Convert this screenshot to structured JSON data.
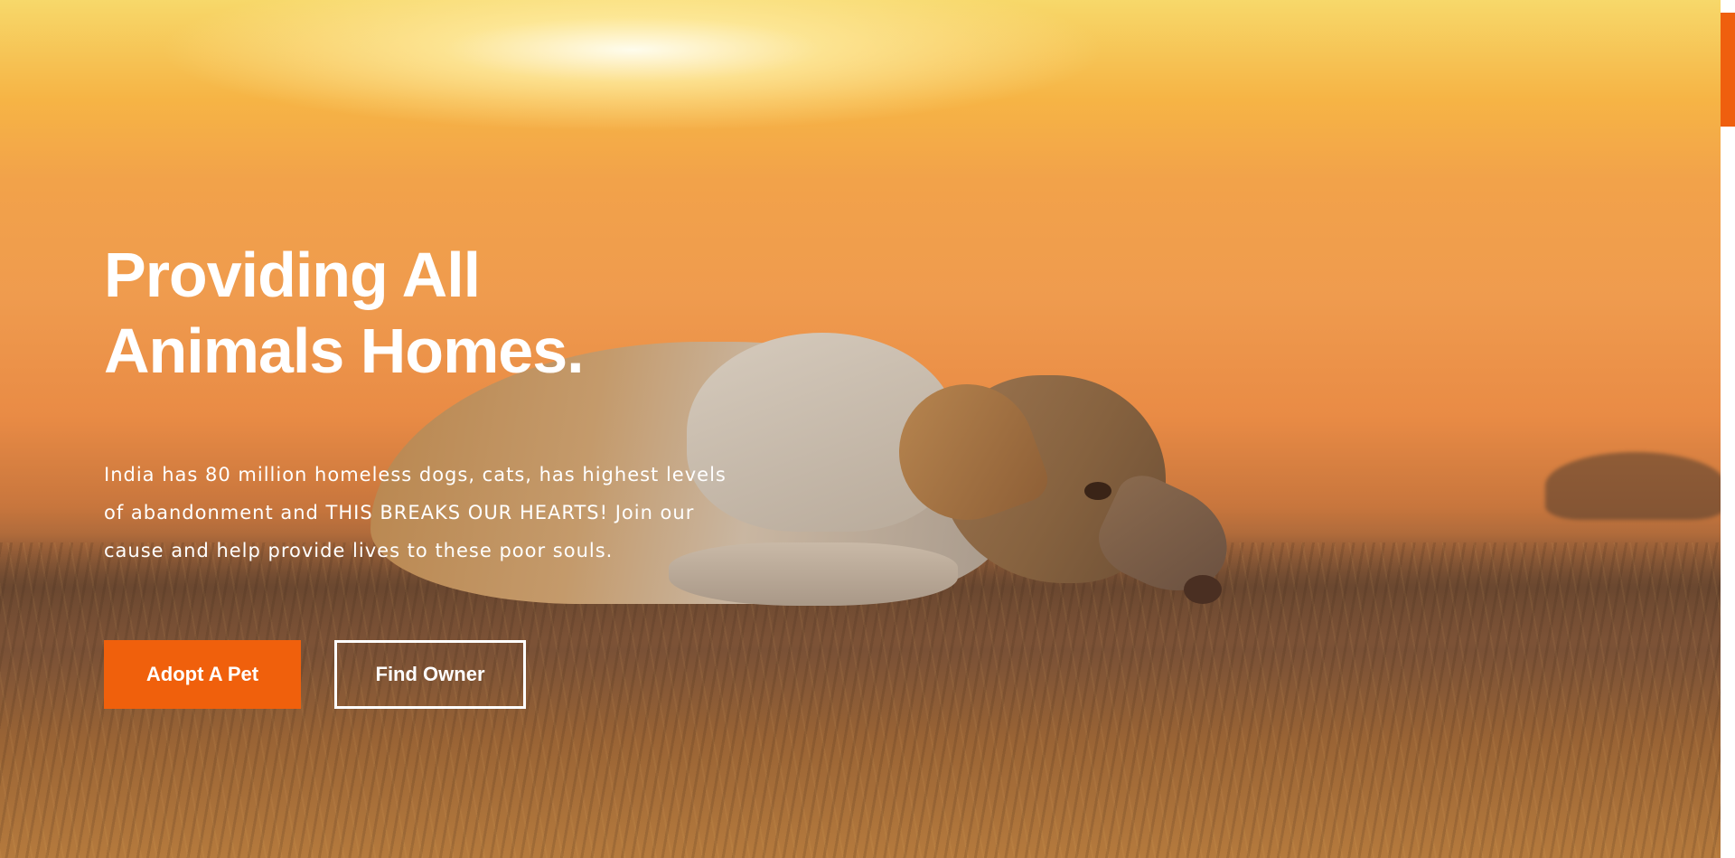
{
  "hero": {
    "headline_line1": "Providing All",
    "headline_line2": "Animals Homes.",
    "description": "India has 80 million homeless dogs, cats, has highest levels of abandonment and THIS BREAKS OUR HEARTS! Join our cause and help provide lives to these poor souls.",
    "primary_button_label": "Adopt A Pet",
    "secondary_button_label": "Find Owner",
    "image_subject": "dog-lying-on-ground-at-sunset"
  },
  "colors": {
    "accent": "#f0600c",
    "text": "#ffffff",
    "scrollbar_thumb": "#ef5f0e"
  }
}
